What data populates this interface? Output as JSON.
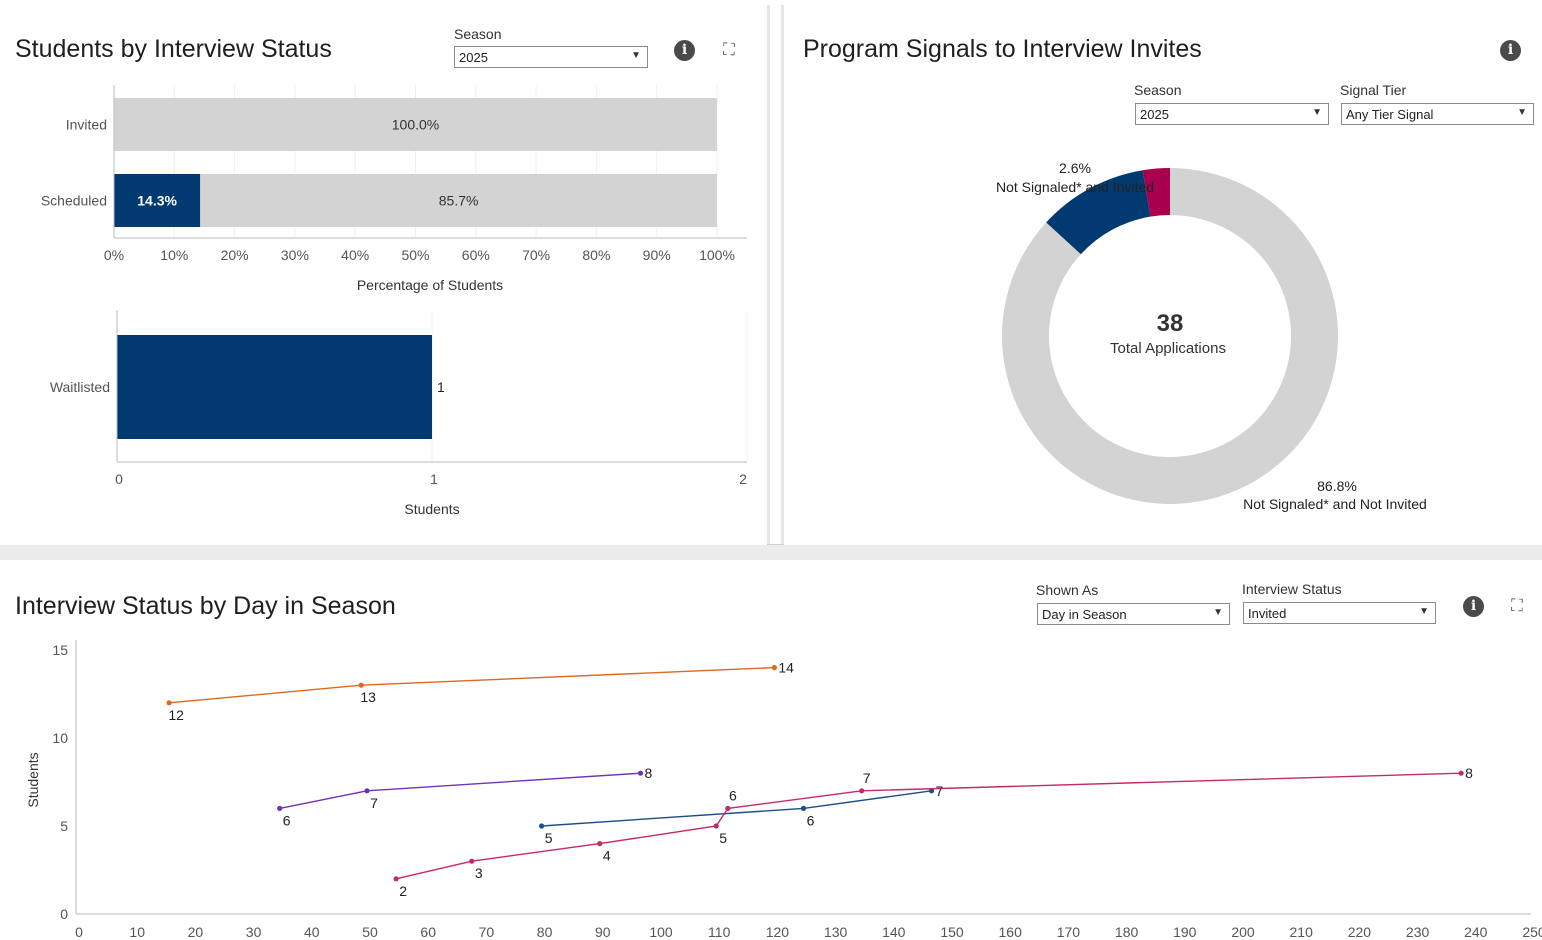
{
  "status_panel": {
    "title": "Students by Interview Status",
    "season_label": "Season",
    "season_value": "2025"
  },
  "signals_panel": {
    "title": "Program Signals to Interview Invites",
    "season_label": "Season",
    "season_value": "2025",
    "tier_label": "Signal Tier",
    "tier_value": "Any Tier Signal"
  },
  "day_panel": {
    "title": "Interview Status by Day in Season",
    "shown_as_label": "Shown As",
    "shown_as_value": "Day in Season",
    "status_label": "Interview Status",
    "status_value": "Invited"
  },
  "colors": {
    "navy": "#003a70",
    "grey": "#d3d3d3",
    "magenta": "#a8004f",
    "orange": "#e0671f",
    "purple": "#7033b8",
    "pink": "#c42a6a"
  },
  "chart_data": [
    {
      "type": "bar",
      "orientation": "horizontal-stacked",
      "categories": [
        "Invited",
        "Scheduled"
      ],
      "series": [
        {
          "values": [
            0,
            14.3
          ],
          "labels": [
            "",
            "14.3%"
          ],
          "color": "#003a70"
        },
        {
          "values": [
            100.0,
            85.7
          ],
          "labels": [
            "100.0%",
            "85.7%"
          ],
          "color": "#d3d3d3"
        }
      ],
      "xlabel": "Percentage of Students",
      "xticks": [
        "0%",
        "10%",
        "20%",
        "30%",
        "40%",
        "50%",
        "60%",
        "70%",
        "80%",
        "90%",
        "100%"
      ],
      "xlim": [
        0,
        100
      ]
    },
    {
      "type": "bar",
      "orientation": "horizontal",
      "categories": [
        "Waitlisted"
      ],
      "values": [
        1
      ],
      "value_labels": [
        "1"
      ],
      "xlabel": "Students",
      "xticks": [
        "0",
        "1",
        "2"
      ],
      "xlim": [
        0,
        2
      ]
    },
    {
      "type": "pie",
      "donut": true,
      "center_value": "38",
      "center_label": "Total Applications",
      "slices": [
        {
          "value": 2.6,
          "color": "#a8004f",
          "label_pct": "",
          "label_name": ""
        },
        {
          "value": 10.6,
          "color": "#003a70",
          "label_pct": "2.6%",
          "label_name": "Not Signaled* and Invited"
        },
        {
          "value": 86.8,
          "color": "#d3d3d3",
          "label_pct": "86.8%",
          "label_name": "Not Signaled* and Not Invited"
        }
      ]
    },
    {
      "type": "line",
      "ylabel": "Students",
      "xlim": [
        0,
        250
      ],
      "ylim": [
        0,
        15
      ],
      "xticks": [
        "0",
        "10",
        "20",
        "30",
        "40",
        "50",
        "60",
        "70",
        "80",
        "90",
        "100",
        "110",
        "120",
        "130",
        "140",
        "150",
        "160",
        "170",
        "180",
        "190",
        "200",
        "210",
        "220",
        "230",
        "240",
        "250"
      ],
      "yticks": [
        "0",
        "5",
        "10",
        "15"
      ],
      "series": [
        {
          "color": "#e0671f",
          "points": [
            [
              16,
              12
            ],
            [
              49,
              13
            ],
            [
              120,
              14
            ]
          ],
          "labels": [
            "12",
            "13",
            "14"
          ]
        },
        {
          "color": "#7033b8",
          "points": [
            [
              35,
              6
            ],
            [
              50,
              7
            ],
            [
              97,
              8
            ]
          ],
          "labels": [
            "6",
            "7",
            "8"
          ]
        },
        {
          "color": "#1c4e8a",
          "points": [
            [
              80,
              5
            ],
            [
              125,
              6
            ],
            [
              147,
              7
            ]
          ],
          "labels": [
            "5",
            "6",
            "7"
          ]
        },
        {
          "color": "#c42a6a",
          "points": [
            [
              55,
              2
            ],
            [
              68,
              3
            ],
            [
              90,
              4
            ],
            [
              110,
              5
            ],
            [
              112,
              6
            ],
            [
              135,
              7
            ],
            [
              238,
              8
            ]
          ],
          "labels": [
            "2",
            "3",
            "4",
            "5",
            "6",
            "7",
            "8"
          ]
        }
      ]
    }
  ]
}
